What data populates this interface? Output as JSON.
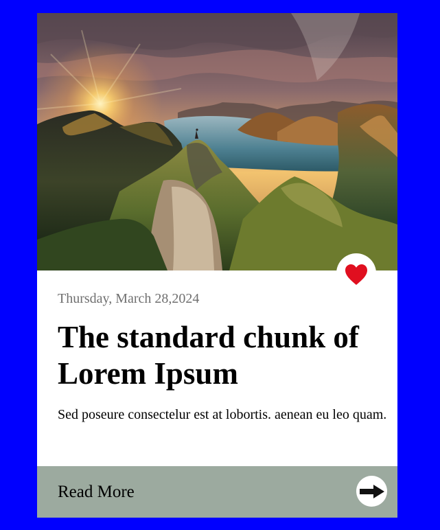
{
  "card": {
    "date": "Thursday, March 28,2024",
    "title": "The standard chunk of Lorem Ipsum",
    "description": "Sed poseure consectelur est at lobortis. aenean eu leo quam.",
    "read_more_label": "Read More",
    "icons": {
      "favorite": "heart-icon",
      "next": "arrow-right-icon"
    }
  },
  "colors": {
    "page_background": "#0000ff",
    "card_background": "#ffffff",
    "footer_background": "#9caa9f",
    "date_text": "#6f6f6f",
    "heart": "#e00f1f",
    "arrow": "#111111"
  }
}
